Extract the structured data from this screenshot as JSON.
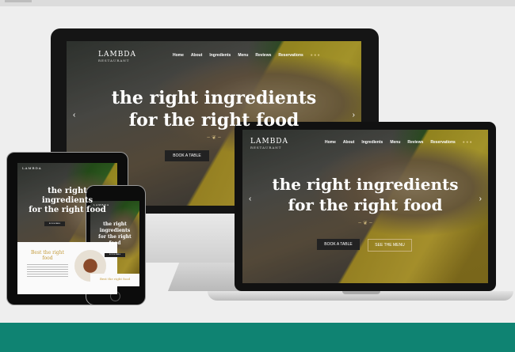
{
  "brand": {
    "name": "LAMBDA",
    "tagline": "RESTAURANT"
  },
  "nav_links": [
    "Home",
    "About",
    "Ingredients",
    "Menu",
    "Reviews",
    "Reservations"
  ],
  "hero": {
    "line1": "the right ingredients",
    "line2": "for the right food",
    "tablet_line1": "the right",
    "tablet_line2": "ingredients",
    "tablet_line3": "for the right food",
    "phone_line1": "the right",
    "phone_line2": "ingredients",
    "phone_line3": "for the right",
    "phone_line4": "food",
    "book_label": "BOOK A TABLE",
    "menu_label": "SEE THE MENU",
    "ornament": "~ ❦ ~"
  },
  "section": {
    "title": "Best the right food",
    "phone_title": "Best the right food"
  },
  "icons": {
    "prev": "chevron-left-icon",
    "next": "chevron-right-icon",
    "apple": "apple-logo-icon"
  },
  "colors": {
    "accent": "#0f8372",
    "gold": "#c39a3a"
  }
}
